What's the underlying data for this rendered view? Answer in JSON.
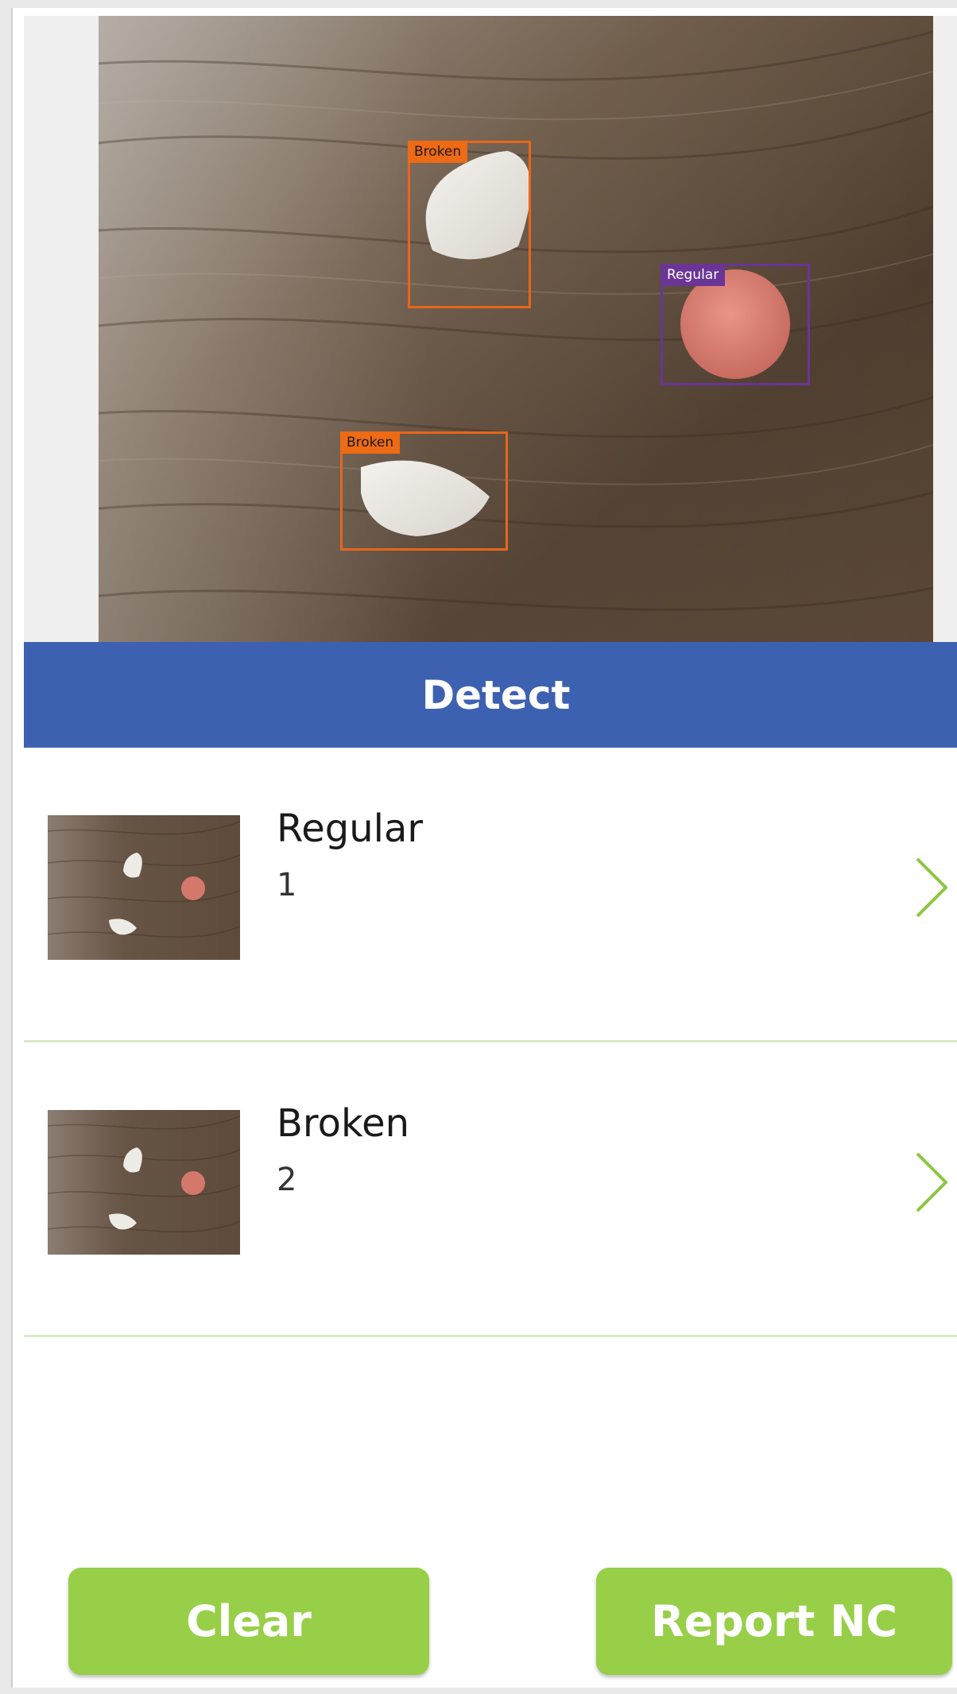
{
  "image": {
    "detections": [
      {
        "label": "Broken",
        "class": "broken"
      },
      {
        "label": "Regular",
        "class": "regular"
      },
      {
        "label": "Broken",
        "class": "broken"
      }
    ]
  },
  "detect_button": {
    "label": "Detect"
  },
  "results": [
    {
      "name": "Regular",
      "count": "1"
    },
    {
      "name": "Broken",
      "count": "2"
    }
  ],
  "buttons": {
    "clear": "Clear",
    "report": "Report NC"
  },
  "colors": {
    "detect_bar": "#3d61b1",
    "button_green": "#98cf48",
    "broken_box": "#e8661a",
    "regular_box": "#6a3596",
    "chevron": "#8cc63f",
    "divider": "#dbe9c4"
  },
  "icons": {
    "chevron": "chevron-right-icon"
  }
}
